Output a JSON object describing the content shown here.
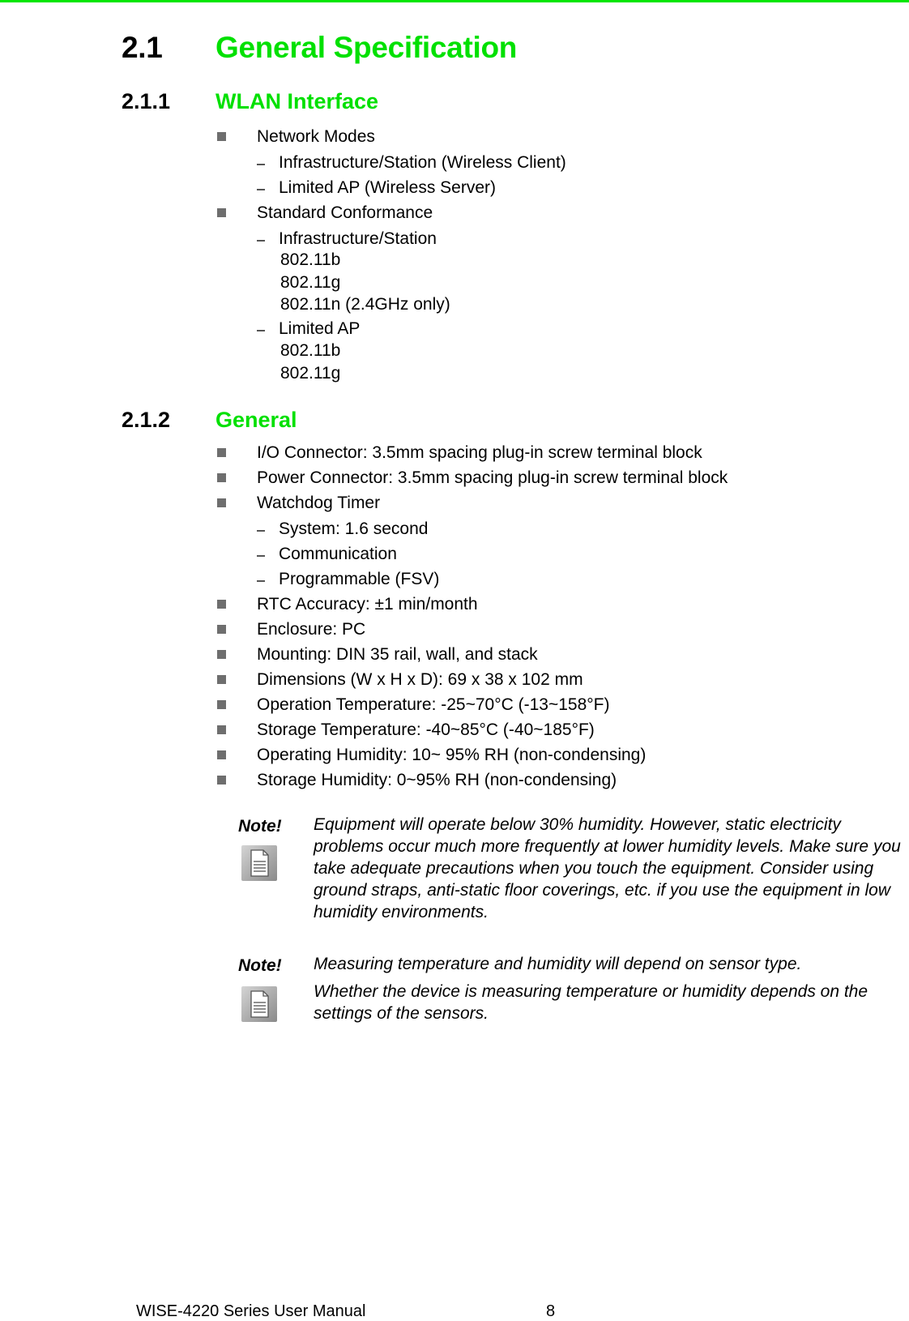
{
  "section": {
    "number": "2.1",
    "title": "General Specification"
  },
  "subsections": [
    {
      "number": "2.1.1",
      "title": "WLAN Interface",
      "items": [
        {
          "label": "Network Modes",
          "children": [
            {
              "label": "Infrastructure/Station (Wireless Client)"
            },
            {
              "label": "Limited AP (Wireless Server)"
            }
          ]
        },
        {
          "label": "Standard Conformance",
          "children": [
            {
              "label": "Infrastructure/Station",
              "values": [
                "802.11b",
                "802.11g",
                "802.11n (2.4GHz only)"
              ]
            },
            {
              "label": "Limited AP",
              "values": [
                "802.11b",
                "802.11g"
              ]
            }
          ]
        }
      ]
    },
    {
      "number": "2.1.2",
      "title": "General",
      "items": [
        {
          "label": "I/O Connector: 3.5mm spacing plug-in screw terminal block"
        },
        {
          "label": "Power Connector: 3.5mm spacing plug-in screw terminal block"
        },
        {
          "label": "Watchdog Timer",
          "children": [
            {
              "label": "System: 1.6 second"
            },
            {
              "label": "Communication"
            },
            {
              "label": "Programmable (FSV)"
            }
          ]
        },
        {
          "label": "RTC Accuracy: ±1 min/month"
        },
        {
          "label": "Enclosure: PC"
        },
        {
          "label": "Mounting: DIN 35 rail, wall, and stack"
        },
        {
          "label": "Dimensions (W x H x D): 69 x 38 x 102 mm"
        },
        {
          "label": "Operation Temperature: -25~70°C (-13~158°F)"
        },
        {
          "label": "Storage Temperature: -40~85°C (-40~185°F)"
        },
        {
          "label": "Operating Humidity: 10~ 95% RH (non-condensing)"
        },
        {
          "label": "Storage Humidity: 0~95% RH (non-condensing)"
        }
      ]
    }
  ],
  "notes": [
    {
      "label": "Note!",
      "icon": "document-icon",
      "paragraphs": [
        "Equipment will operate below 30% humidity. However, static electricity problems occur much more frequently at lower humidity levels. Make sure you take adequate precautions when you touch the equipment. Consider using ground straps, anti-static floor coverings, etc. if you use the equipment in low humidity environments."
      ]
    },
    {
      "label": "Note!",
      "icon": "document-icon",
      "paragraphs": [
        "Measuring temperature and humidity will depend on sensor type.",
        "Whether the device is measuring temperature or humidity depends on the settings of the sensors."
      ]
    }
  ],
  "footer": {
    "manual_title": "WISE-4220 Series User Manual",
    "page_number": "8"
  },
  "colors": {
    "heading_accent": "#00e000",
    "top_rule": "#00e600",
    "bullet": "#6e6e6e"
  }
}
